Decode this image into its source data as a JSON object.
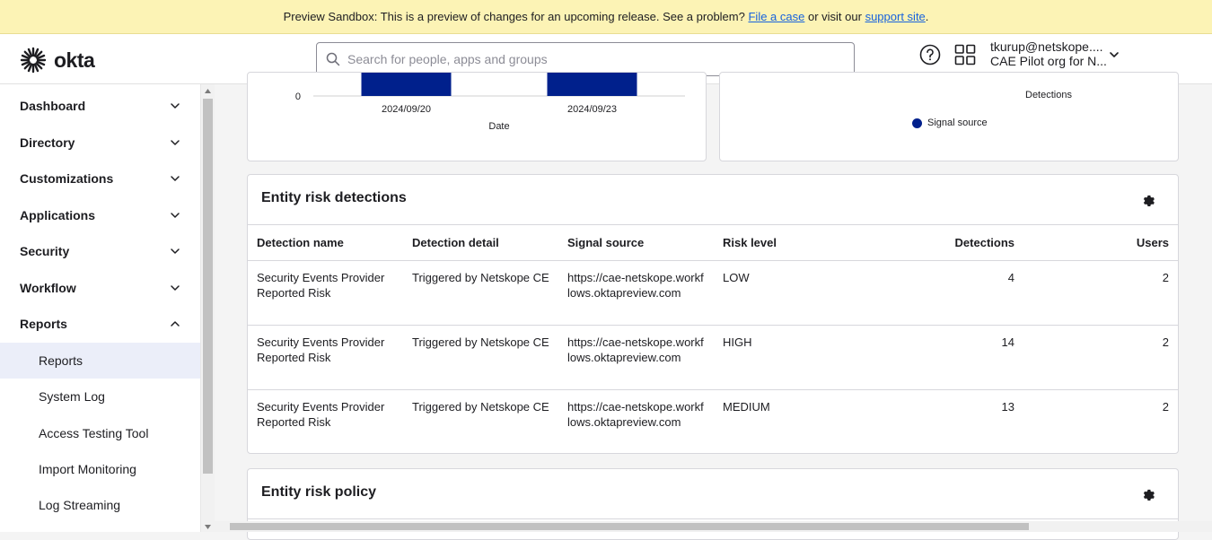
{
  "banner": {
    "prefix": "Preview Sandbox: This is a preview of changes for an upcoming release. See a problem?",
    "link1": "File a case",
    "middle": "or visit our",
    "link2": "support site",
    "suffix": "."
  },
  "brand": {
    "name": "okta"
  },
  "search": {
    "placeholder": "Search for people, apps and groups"
  },
  "user": {
    "email": "tkurup@netskope....",
    "org": "CAE Pilot org for N..."
  },
  "sidebar": {
    "items": [
      {
        "label": "Dashboard"
      },
      {
        "label": "Directory"
      },
      {
        "label": "Customizations"
      },
      {
        "label": "Applications"
      },
      {
        "label": "Security"
      },
      {
        "label": "Workflow"
      },
      {
        "label": "Reports"
      }
    ],
    "reports_sub": [
      {
        "label": "Reports"
      },
      {
        "label": "System Log"
      },
      {
        "label": "Access Testing Tool"
      },
      {
        "label": "Import Monitoring"
      },
      {
        "label": "Log Streaming"
      }
    ]
  },
  "chart_data": [
    {
      "type": "bar",
      "xlabel": "Date",
      "categories": [
        "2024/09/20",
        "2024/09/23"
      ],
      "y_tick_visible": "0",
      "color": "#00208c"
    },
    {
      "type": "pie",
      "label": "Detections",
      "legend": [
        "Signal source"
      ],
      "color": "#00208c"
    }
  ],
  "detections": {
    "title": "Entity risk detections",
    "columns": [
      "Detection name",
      "Detection detail",
      "Signal source",
      "Risk level",
      "Detections",
      "Users"
    ],
    "rows": [
      {
        "name": "Security Events Provider Reported Risk",
        "detail": "Triggered by Netskope CE",
        "source": "https://cae-netskope.workflows.oktapreview.com",
        "risk": "LOW",
        "detections": "4",
        "users": "2"
      },
      {
        "name": "Security Events Provider Reported Risk",
        "detail": "Triggered by Netskope CE",
        "source": "https://cae-netskope.workflows.oktapreview.com",
        "risk": "HIGH",
        "detections": "14",
        "users": "2"
      },
      {
        "name": "Security Events Provider Reported Risk",
        "detail": "Triggered by Netskope CE",
        "source": "https://cae-netskope.workflows.oktapreview.com",
        "risk": "MEDIUM",
        "detections": "13",
        "users": "2"
      }
    ]
  },
  "policy": {
    "title": "Entity risk policy"
  },
  "colors": {
    "accent": "#00208c",
    "banner": "#fcf3b5",
    "link": "#1662dd"
  }
}
